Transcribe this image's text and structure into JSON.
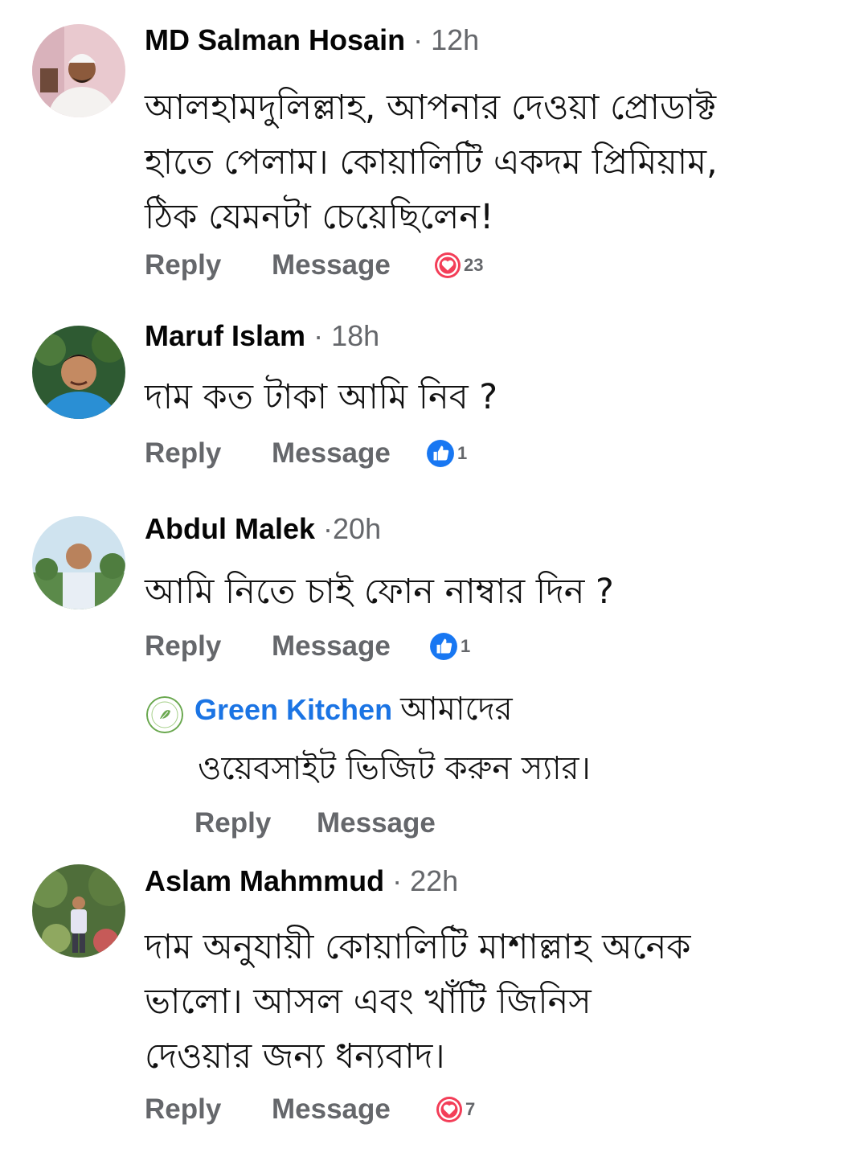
{
  "comments": [
    {
      "name": "MD Salman Hosain",
      "time": "· 12h",
      "text": "আলহামদুলিল্লাহ, আপনার দেওয়া প্রোডাক্ট\nহাতে পেলাম। কোয়ালিটি একদম প্রিমিয়াম,\nঠিক যেমনটা চেয়েছিলেন!",
      "reply_label": "Reply",
      "message_label": "Message",
      "reaction": {
        "type": "heart-icon",
        "count": "23"
      }
    },
    {
      "name": "Maruf Islam",
      "time": "· 18h",
      "text": "দাম কত টাকা আমি নিব ?",
      "reply_label": "Reply",
      "message_label": "Message",
      "reaction": {
        "type": "like-icon",
        "count": "1"
      }
    },
    {
      "name": "Abdul Malek",
      "time": "·20h",
      "text": "আমি নিতে চাই ফোন নাম্বার দিন ?",
      "reply_label": "Reply",
      "message_label": "Message",
      "reaction": {
        "type": "like-icon",
        "count": "1"
      }
    },
    {
      "name": "Aslam Mahmmud",
      "time": "· 22h",
      "text": "দাম অনুযায়ী কোয়ালিটি মাশাল্লাহ অনেক\nভালো। আসল এবং খাঁটি জিনিস\nদেওয়ার জন্য ধন্যবাদ।",
      "reply_label": "Reply",
      "message_label": "Message",
      "reaction": {
        "type": "heart-icon",
        "count": "7"
      }
    }
  ],
  "page_reply": {
    "page_name": "Green Kitchen",
    "logo_text": "GREEN KITCHEN",
    "text_line1": "আমাদের",
    "text_line2": "ওয়েবসাইট ভিজিট করুন স্যার।",
    "reply_label": "Reply",
    "message_label": "Message"
  },
  "colors": {
    "name": "#050505",
    "meta": "#65676b",
    "page_link": "#1b74e4",
    "heart": "#f33e58",
    "like": "#1877f2"
  }
}
